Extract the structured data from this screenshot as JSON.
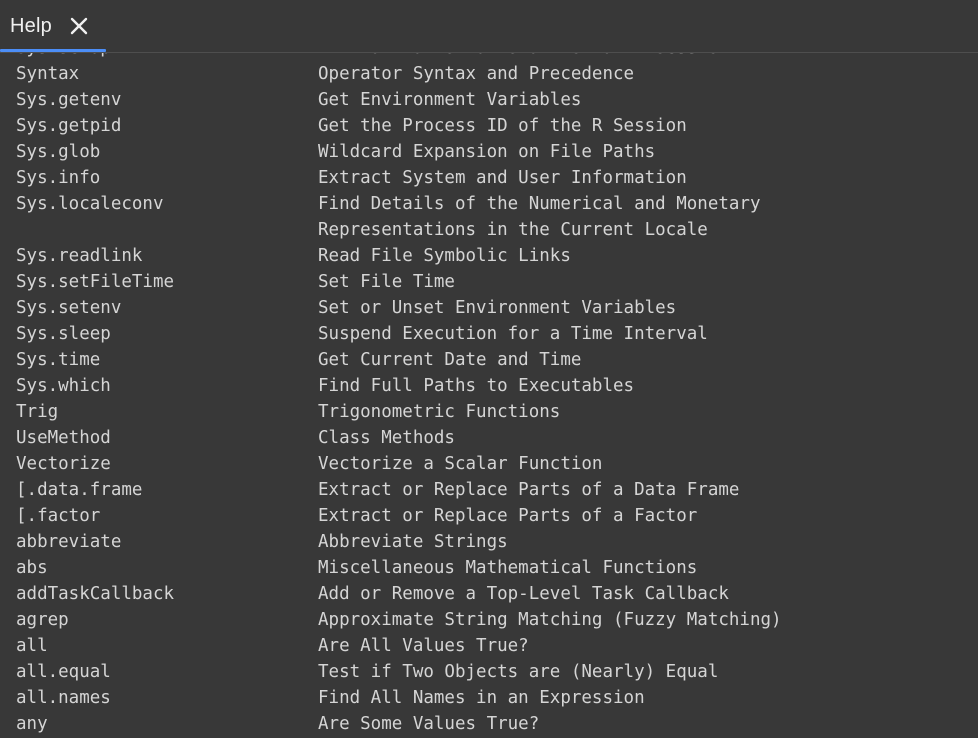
{
  "tab": {
    "label": "Help",
    "close_icon": "close-icon",
    "accent": "#4c8ef7"
  },
  "colors": {
    "background": "#383838",
    "text": "#d5d5d5",
    "tab_text": "#f0f0f0"
  },
  "rows": [
    {
      "topic": "Sys.setup",
      "desc": "Initialization at Start of an R Session",
      "partial": true
    },
    {
      "topic": "Syntax",
      "desc": "Operator Syntax and Precedence"
    },
    {
      "topic": "Sys.getenv",
      "desc": "Get Environment Variables"
    },
    {
      "topic": "Sys.getpid",
      "desc": "Get the Process ID of the R Session"
    },
    {
      "topic": "Sys.glob",
      "desc": "Wildcard Expansion on File Paths"
    },
    {
      "topic": "Sys.info",
      "desc": "Extract System and User Information"
    },
    {
      "topic": "Sys.localeconv",
      "desc": "Find Details of the Numerical and Monetary\nRepresentations in the Current Locale",
      "two_line": true
    },
    {
      "topic": "Sys.readlink",
      "desc": "Read File Symbolic Links"
    },
    {
      "topic": "Sys.setFileTime",
      "desc": "Set File Time"
    },
    {
      "topic": "Sys.setenv",
      "desc": "Set or Unset Environment Variables"
    },
    {
      "topic": "Sys.sleep",
      "desc": "Suspend Execution for a Time Interval"
    },
    {
      "topic": "Sys.time",
      "desc": "Get Current Date and Time"
    },
    {
      "topic": "Sys.which",
      "desc": "Find Full Paths to Executables"
    },
    {
      "topic": "Trig",
      "desc": "Trigonometric Functions"
    },
    {
      "topic": "UseMethod",
      "desc": "Class Methods"
    },
    {
      "topic": "Vectorize",
      "desc": "Vectorize a Scalar Function"
    },
    {
      "topic": "[.data.frame",
      "desc": "Extract or Replace Parts of a Data Frame"
    },
    {
      "topic": "[.factor",
      "desc": "Extract or Replace Parts of a Factor"
    },
    {
      "topic": "abbreviate",
      "desc": "Abbreviate Strings"
    },
    {
      "topic": "abs",
      "desc": "Miscellaneous Mathematical Functions"
    },
    {
      "topic": "addTaskCallback",
      "desc": "Add or Remove a Top-Level Task Callback"
    },
    {
      "topic": "agrep",
      "desc": "Approximate String Matching (Fuzzy Matching)"
    },
    {
      "topic": "all",
      "desc": "Are All Values True?"
    },
    {
      "topic": "all.equal",
      "desc": "Test if Two Objects are (Nearly) Equal"
    },
    {
      "topic": "all.names",
      "desc": "Find All Names in an Expression"
    },
    {
      "topic": "any",
      "desc": "Are Some Values True?"
    }
  ]
}
